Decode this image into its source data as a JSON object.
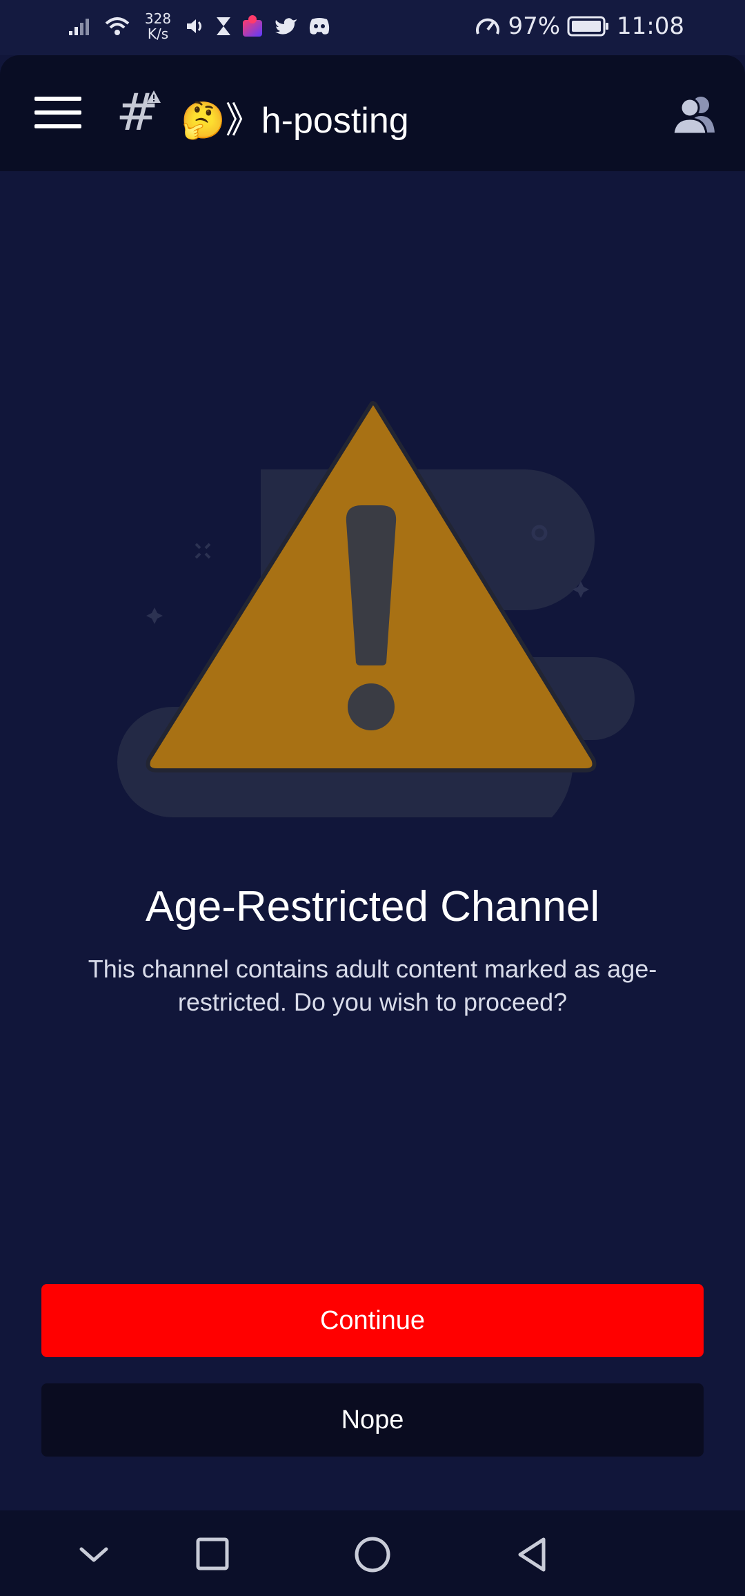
{
  "status_bar": {
    "net_speed_value": "328",
    "net_speed_unit": "K/s",
    "battery": "97%",
    "time": "11:08"
  },
  "app_bar": {
    "channel_name": "🤔》h-posting",
    "hash_icon": "#"
  },
  "warning": {
    "title": "Age-Restricted Channel",
    "message": "This channel contains adult content marked as age-restricted. Do you wish to proceed?"
  },
  "buttons": {
    "continue_label": "Continue",
    "nope_label": "Nope"
  },
  "colors": {
    "background": "#11163a",
    "app_bar": "#090d24",
    "warning_triangle": "#a87114",
    "continue_button": "#ff0000",
    "nope_button": "#0a0c20"
  },
  "icons": {
    "menu": "hamburger-icon",
    "members": "members-icon",
    "nav": [
      "chevron-down-icon",
      "recents-square-icon",
      "home-circle-icon",
      "back-triangle-icon"
    ]
  }
}
